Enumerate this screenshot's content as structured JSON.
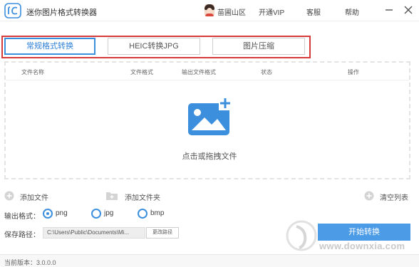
{
  "titlebar": {
    "app_title": "迷你图片格式转换器",
    "username": "苗圃山区",
    "links": [
      "开通VIP",
      "客服",
      "帮助"
    ]
  },
  "tabs": [
    {
      "label": "常规格式转换",
      "active": true
    },
    {
      "label": "HEIC转换JPG",
      "active": false
    },
    {
      "label": "图片压缩",
      "active": false
    }
  ],
  "table": {
    "columns": [
      "文件名称",
      "文件格式",
      "输出文件格式",
      "状态",
      "操作"
    ]
  },
  "drop_text": "点击或拖拽文件",
  "actions": {
    "add_file": "添加文件",
    "add_folder": "添加文件夹",
    "clear_list": "清空列表"
  },
  "output_format": {
    "label": "输出格式：",
    "options": [
      "png",
      "jpg",
      "bmp"
    ],
    "selected": "png"
  },
  "save_path": {
    "label": "保存路径：",
    "value": "C:\\Users\\Public\\Documents\\Mi...",
    "change_label": "更改路径"
  },
  "start_button": "开始转换",
  "status": {
    "version": "当前版本：3.0.0.0"
  },
  "watermark": "www.downxia.com",
  "colors": {
    "accent": "#3c8fdd",
    "tab_highlight_frame": "#d63a3a",
    "start_button": "#4c9be6"
  }
}
